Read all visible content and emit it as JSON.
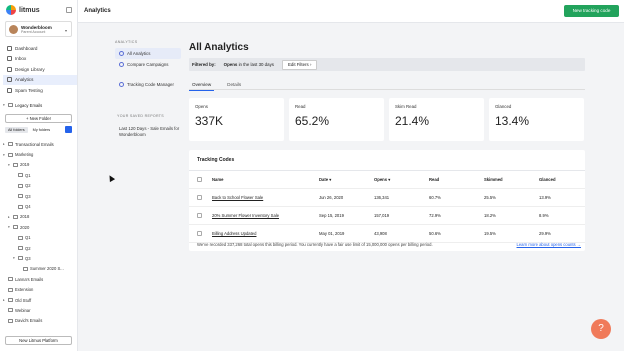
{
  "brand": {
    "name": "litmus"
  },
  "account": {
    "name": "Wonderbloom",
    "role": "Parent Account"
  },
  "nav": [
    {
      "label": "Dashboard",
      "icon": "home-icon"
    },
    {
      "label": "Inbox",
      "icon": "inbox-icon"
    },
    {
      "label": "Design Library",
      "icon": "library-icon"
    },
    {
      "label": "Analytics",
      "icon": "chart-icon",
      "active": true
    },
    {
      "label": "Spam Testing",
      "icon": "shield-icon"
    }
  ],
  "legacy": {
    "label": "Legacy Emails"
  },
  "sidebar_buttons": {
    "new_folder": "+ New Folder",
    "all_folders": "All folders",
    "my_folders": "My folders",
    "new_platform": "New Litmus Platform"
  },
  "tree": [
    {
      "label": "Transactional Emails",
      "indent": 0,
      "caret": "▸"
    },
    {
      "label": "Marketing",
      "indent": 0,
      "caret": "▾"
    },
    {
      "label": "2019",
      "indent": 1,
      "caret": "▾"
    },
    {
      "label": "Q1",
      "indent": 2,
      "caret": ""
    },
    {
      "label": "Q2",
      "indent": 2,
      "caret": ""
    },
    {
      "label": "Q3",
      "indent": 2,
      "caret": ""
    },
    {
      "label": "Q4",
      "indent": 2,
      "caret": ""
    },
    {
      "label": "2018",
      "indent": 1,
      "caret": "▸"
    },
    {
      "label": "2020",
      "indent": 1,
      "caret": "▾"
    },
    {
      "label": "Q1",
      "indent": 2,
      "caret": ""
    },
    {
      "label": "Q2",
      "indent": 2,
      "caret": ""
    },
    {
      "label": "Q3",
      "indent": 2,
      "caret": "▾"
    },
    {
      "label": "Summer 2020 S...",
      "indent": 3,
      "caret": ""
    },
    {
      "label": "Lanna's Emails",
      "indent": 0,
      "caret": ""
    },
    {
      "label": "Extension",
      "indent": 0,
      "caret": ""
    },
    {
      "label": "Old Stuff",
      "indent": 0,
      "caret": "▸"
    },
    {
      "label": "Webinar",
      "indent": 0,
      "caret": ""
    },
    {
      "label": "David's Emails",
      "indent": 0,
      "caret": ""
    }
  ],
  "topbar": {
    "title": "Analytics",
    "new_button": "New tracking code"
  },
  "subnav": {
    "heading": "ANALYTICS",
    "items": [
      {
        "label": "All Analytics",
        "active": true
      },
      {
        "label": "Compare Campaigns"
      }
    ],
    "tracking_manager": "Tracking Code Manager",
    "saved_heading": "YOUR SAVED REPORTS",
    "saved_item": "Last 120 Days - Sale Emails for Wonderbloom"
  },
  "main": {
    "title": "All Analytics",
    "filter_label": "Filtered by:",
    "filter_value_bold": "Opens",
    "filter_value": " in the last 30 days",
    "edit_filters": "Edit Filters",
    "tabs": [
      "Overview",
      "Details"
    ]
  },
  "cards": [
    {
      "label": "Opens",
      "value": "337K"
    },
    {
      "label": "Read",
      "value": "65.2%"
    },
    {
      "label": "Skim Read",
      "value": "21.4%"
    },
    {
      "label": "Glanced",
      "value": "13.4%"
    }
  ],
  "table": {
    "title": "Tracking Codes",
    "headers": [
      "Name",
      "Date",
      "Opens",
      "Read",
      "Skimmed",
      "Glanced"
    ],
    "rows": [
      [
        "Back to School Flower Sale",
        "Jun 26, 2020",
        "136,341",
        "60.7%",
        "25.5%",
        "13.9%"
      ],
      [
        "20% Summer Flower Inventory Sale",
        "Sep 15, 2019",
        "157,019",
        "72.9%",
        "18.2%",
        "8.9%"
      ],
      [
        "Billing Address Updated",
        "May 01, 2019",
        "43,908",
        "50.6%",
        "19.5%",
        "29.9%"
      ]
    ],
    "footer": "We've recorded 337,268 total opens this billing period. You currently have a fair use limit of 15,000,000 opens per billing period.",
    "footer_link": "Learn more about opens counts →"
  },
  "help": {
    "glyph": "?"
  }
}
